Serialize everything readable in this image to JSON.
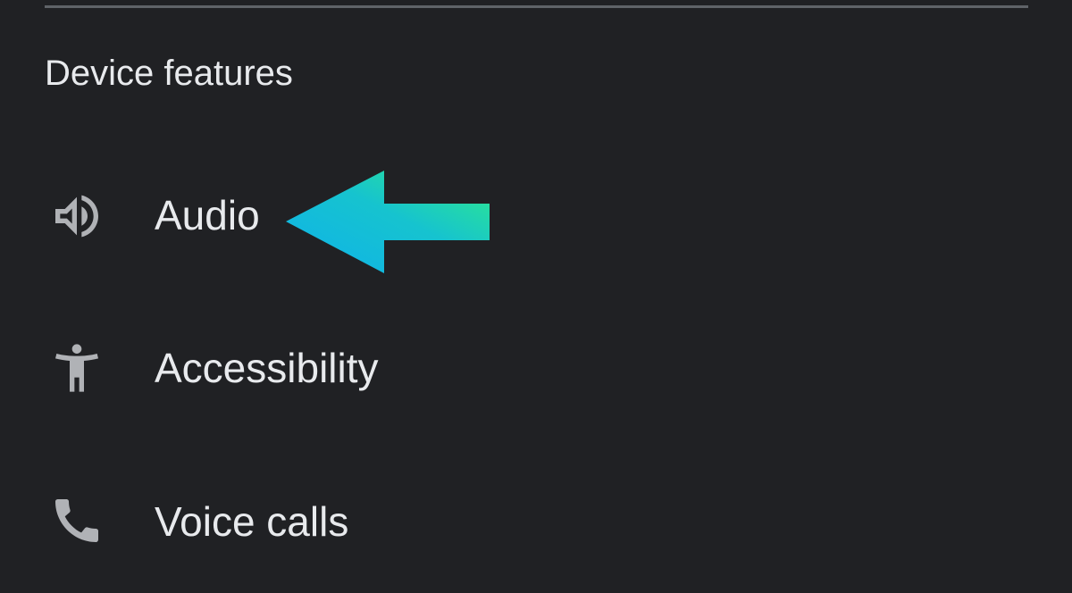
{
  "section": {
    "title": "Device features"
  },
  "items": [
    {
      "label": "Audio",
      "icon": "speaker-icon"
    },
    {
      "label": "Accessibility",
      "icon": "accessibility-icon"
    },
    {
      "label": "Voice calls",
      "icon": "phone-icon"
    }
  ],
  "annotation": {
    "type": "pointer-arrow",
    "target": "Audio",
    "gradient_start": "#10b2ea",
    "gradient_end": "#2ee88a"
  },
  "colors": {
    "background": "#202124",
    "text": "#e8eaed",
    "icon": "#b0b2b6",
    "divider": "#5f6368"
  }
}
